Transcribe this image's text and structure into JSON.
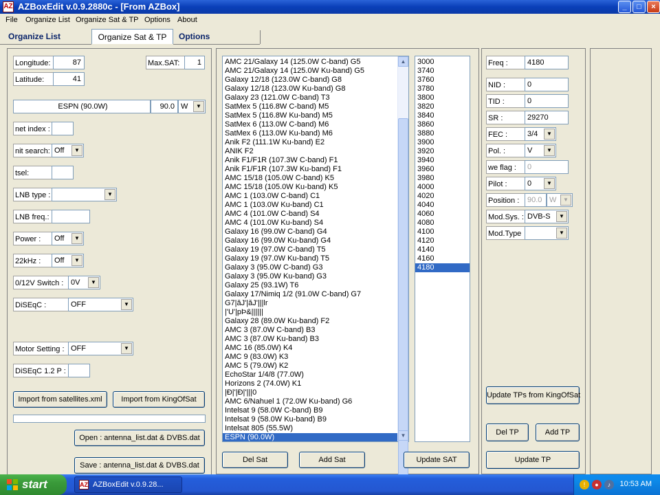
{
  "window": {
    "title": "AZBoxEdit   v.0.9.2880c  -  [From AZBox]",
    "icon": "AZ",
    "controls": {
      "minimize": "_",
      "maximize": "□",
      "close": "×"
    }
  },
  "menu": [
    "File",
    "Organize List",
    "Organize Sat & TP",
    "Options",
    "About"
  ],
  "tabs": [
    "Organize List",
    "Organize Sat & TP",
    "Options"
  ],
  "left": {
    "longitude_label": "Longitude:",
    "longitude": "87",
    "latitude_label": "Latitude:",
    "latitude": "41",
    "maxsat_label": "Max.SAT:",
    "maxsat": "1",
    "selected_sat": "ESPN (90.0W)",
    "sat_pos": "90.0",
    "sat_dir": "W",
    "net_index_label": "net index :",
    "net_index": "",
    "nit_search_label": "nit search:",
    "nit_search": "Off",
    "tsel_label": "tsel:",
    "tsel": "",
    "lnb_type_label": "LNB type :",
    "lnb_type": "",
    "lnb_freq_label": "LNB freq.:",
    "lnb_freq": "",
    "power_label": "Power :",
    "power": "Off",
    "khz22_label": "22kHz :",
    "khz22": "Off",
    "switch_label": "0/12V Switch :",
    "switch": "0V",
    "diseqc_label": "DiSEqC :",
    "diseqc": "OFF",
    "motor_label": "Motor Setting :",
    "motor": "OFF",
    "diseqc12_label": "DiSEqC 1.2 P :",
    "diseqc12": "",
    "import_sat_xml": "Import from satellites.xml",
    "import_kingofsat": "Import from KingOfSat",
    "open_btn": "Open : antenna_list.dat  &  DVBS.dat",
    "save_btn": "Save : antenna_list.dat  &  DVBS.dat"
  },
  "satellites": [
    "AMC 21/Galaxy 14 (125.0W C-band) G5",
    "AMC 21/Galaxy 14 (125.0W Ku-band) G5",
    "Galaxy 12/18 (123.0W C-band) G8",
    "Galaxy 12/18 (123.0W Ku-band) G8",
    "Galaxy 23 (121.0W C-band) T3",
    "SatMex 5 (116.8W C-band) M5",
    "SatMex 5 (116.8W Ku-band) M5",
    "SatMex 6 (113.0W C-band) M6",
    "SatMex 6 (113.0W Ku-band) M6",
    "Anik F2 (111.1W Ku-band) E2",
    "ANIK F2",
    "Anik F1/F1R (107.3W C-band) F1",
    "Anik F1/F1R (107.3W Ku-band) F1",
    "AMC 15/18 (105.0W C-band) K5",
    "AMC 15/18 (105.0W Ku-band) K5",
    "AMC 1 (103.0W C-band) C1",
    "AMC 1 (103.0W Ku-band) C1",
    "AMC 4 (101.0W C-band) S4",
    "AMC 4 (101.0W Ku-band) S4",
    "Galaxy 16 (99.0W C-band) G4",
    "Galaxy 16 (99.0W Ku-band) G4",
    "Galaxy 19 (97.0W C-band) T5",
    "Galaxy 19 (97.0W Ku-band) T5",
    "Galaxy 3  (95.0W C-band) G3",
    "Galaxy 3  (95.0W Ku-band) G3",
    "Galaxy 25 (93.1W) T6",
    "Galaxy 17/Nimiq 1/2 (91.0W C-band) G7",
    "G7|ǎJ'|ǎJ'|||lr",
    "|'U'|pÞ&||||||",
    "Galaxy 28 (89.0W Ku-band) F2",
    "AMC 3 (87.0W C-band) B3",
    "AMC 3 (87.0W Ku-band) B3",
    "AMC 16 (85.0W) K4",
    "AMC 9 (83.0W) K3",
    "AMC 5 (79.0W) K2",
    "EchoStar 1/4/8 (77.0W)",
    "Horizons 2 (74.0W) K1",
    "|Ð|'|Ð|'|||0",
    "AMC 6/Nahuel 1 (72.0W Ku-band) G6",
    "Intelsat 9 (58.0W C-band) B9",
    "Intelsat 9 (58.0W Ku-band) B9",
    "Intelsat 805 (55.5W)",
    "ESPN (90.0W)"
  ],
  "satellites_selected": 42,
  "sat_buttons": {
    "del": "Del Sat",
    "add": "Add Sat",
    "update": "Update SAT"
  },
  "transponders": [
    "3000",
    "3740",
    "3760",
    "3780",
    "3800",
    "3820",
    "3840",
    "3860",
    "3880",
    "3900",
    "3920",
    "3940",
    "3960",
    "3980",
    "4000",
    "4020",
    "4040",
    "4060",
    "4080",
    "4100",
    "4120",
    "4140",
    "4160",
    "4180"
  ],
  "transponders_selected": 23,
  "tp": {
    "freq_label": "Freq :",
    "freq": "4180",
    "nid_label": "NID :",
    "nid": "0",
    "tid_label": "TID :",
    "tid": "0",
    "sr_label": "SR :",
    "sr": "29270",
    "fec_label": "FEC :",
    "fec": "3/4",
    "pol_label": "Pol. :",
    "pol": "V",
    "weflag_label": "we flag :",
    "weflag": "0",
    "pilot_label": "Pilot :",
    "pilot": "0",
    "position_label": "Position :",
    "position": "90.0",
    "position_dir": "W",
    "modsys_label": "Mod.Sys. :",
    "modsys": "DVB-S",
    "modtype_label": "Mod.Type",
    "modtype": "",
    "update_kingofsat": "Update TPs from KingOfSat",
    "del_tp": "Del TP",
    "add_tp": "Add TP",
    "update_tp": "Update TP"
  },
  "taskbar": {
    "start": "start",
    "item": "AZBoxEdit   v.0.9.28...",
    "clock": "10:53 AM"
  },
  "colors": {
    "titlebar": "#0a3fb8",
    "selection": "#316ac5",
    "window_bg": "#ece9d8",
    "taskbar": "#245edb",
    "start": "#3a9a3a"
  }
}
